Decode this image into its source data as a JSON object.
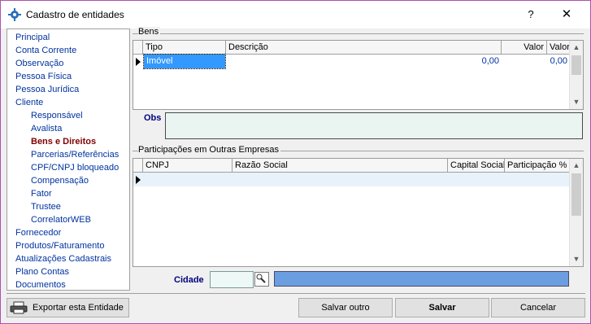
{
  "window": {
    "title": "Cadastro de entidades",
    "help_label": "?",
    "close_label": "✕"
  },
  "sidebar": {
    "items": [
      {
        "label": "Principal",
        "level": 0
      },
      {
        "label": "Conta Corrente",
        "level": 0
      },
      {
        "label": "Observação",
        "level": 0
      },
      {
        "label": "Pessoa Física",
        "level": 0
      },
      {
        "label": "Pessoa Jurídica",
        "level": 0
      },
      {
        "label": "Cliente",
        "level": 0
      },
      {
        "label": "Responsável",
        "level": 1
      },
      {
        "label": "Avalista",
        "level": 1
      },
      {
        "label": "Bens e Direitos",
        "level": 1,
        "active": true
      },
      {
        "label": "Parcerias/Referências",
        "level": 1
      },
      {
        "label": "CPF/CNPJ bloqueado",
        "level": 1
      },
      {
        "label": "Compensação",
        "level": 1
      },
      {
        "label": "Fator",
        "level": 1
      },
      {
        "label": "Trustee",
        "level": 1
      },
      {
        "label": "CorrelatorWEB",
        "level": 1
      },
      {
        "label": "Fornecedor",
        "level": 0
      },
      {
        "label": "Produtos/Faturamento",
        "level": 0
      },
      {
        "label": "Atualizações Cadastrais",
        "level": 0
      },
      {
        "label": "Plano Contas",
        "level": 0
      },
      {
        "label": "Documentos",
        "level": 0
      }
    ]
  },
  "bens": {
    "group_title": "Bens",
    "columns": [
      "Tipo",
      "Descrição",
      "Valor",
      "Valor Finan."
    ],
    "rows": [
      {
        "tipo": "Imóvel",
        "descricao": "",
        "valor": "0,00",
        "valor_finan": "0,00"
      }
    ]
  },
  "obs": {
    "label": "Obs",
    "value": ""
  },
  "participacoes": {
    "group_title": "Participações em Outras Empresas",
    "columns": [
      "CNPJ",
      "Razão Social",
      "Capital Social",
      "Participação %"
    ]
  },
  "cidade": {
    "label": "Cidade",
    "code_value": "",
    "name_value": ""
  },
  "buttons": {
    "export": "Exportar esta Entidade",
    "save_other": "Salvar outro",
    "save": "Salvar",
    "cancel": "Cancelar"
  },
  "colors": {
    "nav_link": "#0033a0",
    "nav_active": "#800000",
    "selected_cell": "#3399ff",
    "obs_bg": "#eaf5f1",
    "cidade_name_bg": "#6b9ee0"
  }
}
